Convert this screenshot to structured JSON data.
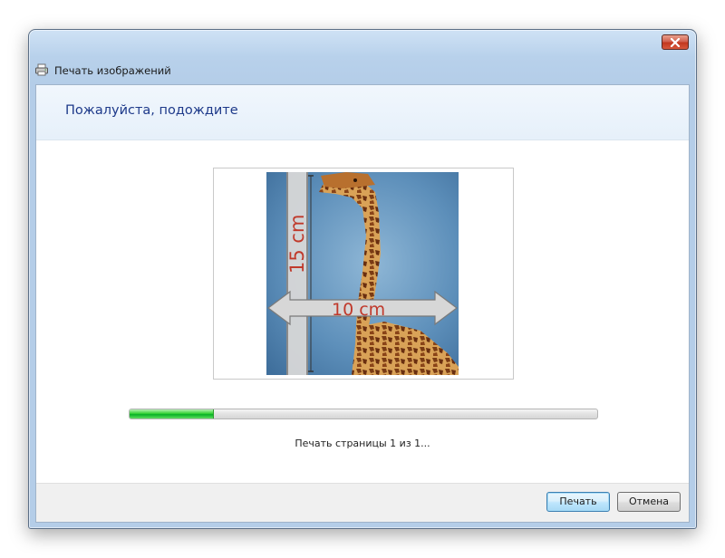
{
  "window": {
    "title": "Печать изображений",
    "icon": "printer-icon",
    "close_icon": "close-icon"
  },
  "header": {
    "heading": "Пожалуйста, подождите"
  },
  "preview": {
    "height_label": "15 cm",
    "width_label": "10 cm",
    "image": "giraffe-photo"
  },
  "progress": {
    "value_percent": 18,
    "status_text": "Печать страницы 1 из 1..."
  },
  "buttons": {
    "print_label": "Печать",
    "cancel_label": "Отмена"
  },
  "colors": {
    "accent": "#1e3a8a",
    "progress": "#06b025",
    "close_button": "#c2381f",
    "label_red": "#c0392b"
  }
}
